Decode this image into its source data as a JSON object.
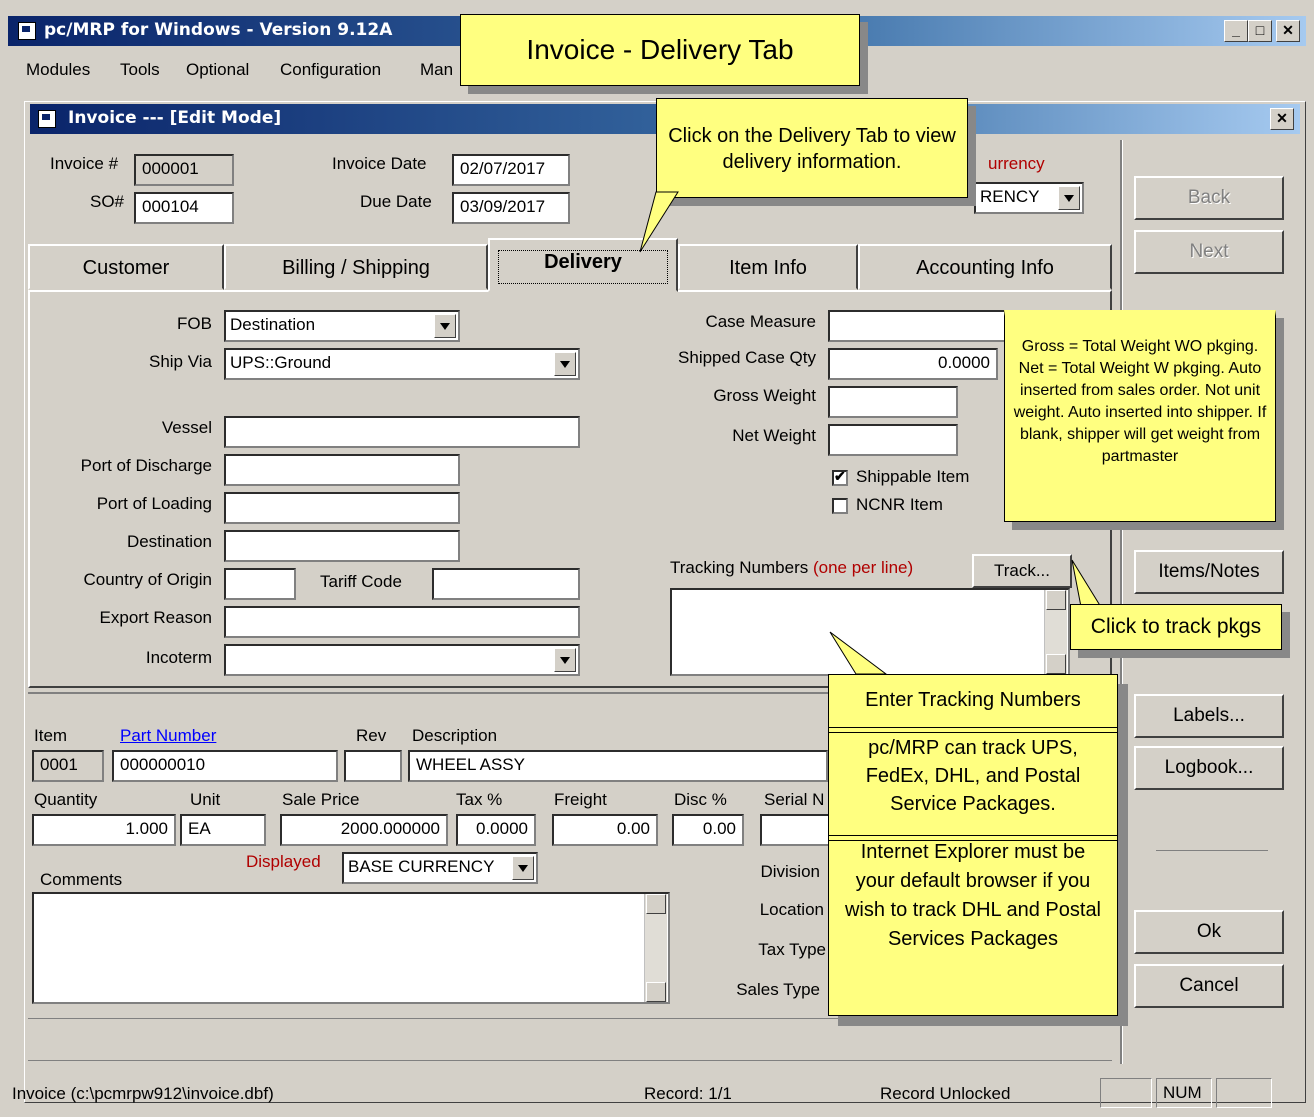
{
  "app": {
    "title": "pc/MRP for Windows - Version 9.12A",
    "menu": [
      "Modules",
      "Tools",
      "Optional",
      "Configuration",
      "Man"
    ]
  },
  "child": {
    "title": "Invoice --- [Edit Mode]"
  },
  "header": {
    "invoice_label": "Invoice #",
    "invoice_value": "000001",
    "so_label": "SO#",
    "so_value": "000104",
    "invoice_date_label": "Invoice Date",
    "invoice_date_value": "02/07/2017",
    "due_date_label": "Due Date",
    "due_date_value": "03/09/2017",
    "currency_label": "urrency",
    "currency_value": "RENCY"
  },
  "side_buttons": {
    "back": "Back",
    "next": "Next",
    "items_notes": "Items/Notes",
    "labels": "Labels...",
    "logbook": "Logbook...",
    "ok": "Ok",
    "cancel": "Cancel"
  },
  "tabs": {
    "customer": "Customer",
    "billing": "Billing / Shipping",
    "delivery": "Delivery",
    "item_info": "Item Info",
    "accounting": "Accounting Info"
  },
  "delivery": {
    "fob_label": "FOB",
    "fob_value": "Destination",
    "ship_via_label": "Ship Via",
    "ship_via_value": "UPS::Ground",
    "vessel_label": "Vessel",
    "port_discharge_label": "Port of Discharge",
    "port_loading_label": "Port of Loading",
    "destination_label": "Destination",
    "country_origin_label": "Country of Origin",
    "tariff_label": "Tariff Code",
    "export_reason_label": "Export Reason",
    "incoterm_label": "Incoterm",
    "case_measure_label": "Case Measure",
    "shipped_case_qty_label": "Shipped Case Qty",
    "shipped_case_qty_value": "0.0000",
    "gross_weight_label": "Gross Weight",
    "net_weight_label": "Net Weight",
    "shippable_label": "Shippable Item",
    "ncnr_label": "NCNR Item",
    "tracking_label": "Tracking Numbers",
    "tracking_hint": "(one per line)",
    "track_button": "Track..."
  },
  "item": {
    "item_label": "Item",
    "item_value": "0001",
    "part_label": "Part Number",
    "part_value": "000000010",
    "rev_label": "Rev",
    "desc_label": "Description",
    "desc_value": "WHEEL ASSY",
    "qty_label": "Quantity",
    "qty_value": "1.000",
    "unit_label": "Unit",
    "unit_value": "EA",
    "price_label": "Sale Price",
    "price_value": "2000.000000",
    "tax_label": "Tax %",
    "tax_value": "0.0000",
    "freight_label": "Freight",
    "freight_value": "0.00",
    "disc_label": "Disc %",
    "disc_value": "0.00",
    "serial_label": "Serial N",
    "comments_label": "Comments",
    "displayed_label": "Displayed",
    "displayed_value": "BASE CURRENCY",
    "division_label": "Division",
    "location_label": "Location",
    "tax_type_label": "Tax Type",
    "sales_type_label": "Sales Type"
  },
  "callouts": {
    "title": "Invoice - Delivery Tab",
    "delivery_tab": "Click on the Delivery Tab to view delivery information.",
    "weight": "Gross = Total Weight WO pkging. Net = Total Weight W pkging. Auto inserted from sales order. Not unit weight. Auto inserted into shipper. If blank, shipper will get weight from partmaster",
    "track_pkgs": "Click to track pkgs",
    "enter_tracking": "Enter Tracking Numbers",
    "carriers": "pc/MRP can track UPS, FedEx, DHL, and Postal Service Packages.",
    "ie": "Internet Explorer must be your default browser if you wish to track DHL and Postal Services Packages"
  },
  "status": {
    "file": "Invoice (c:\\pcmrpw912\\invoice.dbf)",
    "record": "Record: 1/1",
    "lock": "Record Unlocked",
    "num": "NUM"
  },
  "colors": {
    "title_bar": "#0a246a",
    "note_bg": "#ffff80",
    "red_label": "#b00000",
    "link_blue": "#0000ff"
  }
}
